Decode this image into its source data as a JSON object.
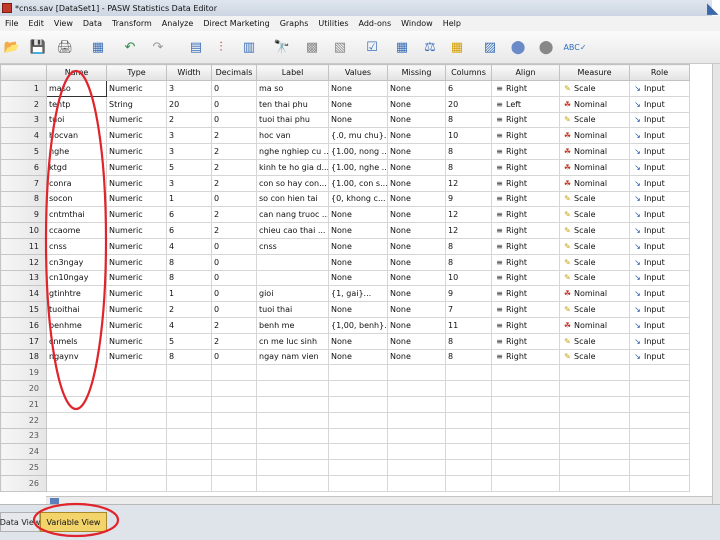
{
  "window": {
    "title": "*cnss.sav [DataSet1] - PASW Statistics Data Editor",
    "logo_glyph": "◣"
  },
  "menu": [
    "File",
    "Edit",
    "View",
    "Data",
    "Transform",
    "Analyze",
    "Direct Marketing",
    "Graphs",
    "Utilities",
    "Add-ons",
    "Window",
    "Help"
  ],
  "toolbar": {
    "icons": [
      {
        "name": "open-folder-icon",
        "glyph": "📂",
        "color": "#e0a000"
      },
      {
        "name": "save-icon",
        "glyph": "💾",
        "color": "#2e5fa8"
      },
      {
        "name": "print-icon",
        "glyph": "🖨",
        "color": "#555555"
      },
      {
        "name": "dialog-recall-icon",
        "glyph": "▦",
        "color": "#3b6fb8"
      },
      {
        "name": "undo-icon",
        "glyph": "↶",
        "color": "#2d8a4e"
      },
      {
        "name": "redo-icon",
        "glyph": "↷",
        "color": "#9a9a9a"
      },
      {
        "name": "goto-case-icon",
        "glyph": "▤",
        "color": "#3b6fb8"
      },
      {
        "name": "goto-variable-icon",
        "glyph": "⫶",
        "color": "#b03030"
      },
      {
        "name": "variables-icon",
        "glyph": "▥",
        "color": "#3b6fb8"
      },
      {
        "name": "find-icon",
        "glyph": "🔭",
        "color": "#222222"
      },
      {
        "name": "insert-cases-icon",
        "glyph": "▩",
        "color": "#888888"
      },
      {
        "name": "insert-variable-icon",
        "glyph": "▧",
        "color": "#888888"
      },
      {
        "name": "split-file-icon",
        "glyph": "☑",
        "color": "#3b6fb8"
      },
      {
        "name": "select-cases-icon",
        "glyph": "▦",
        "color": "#3b6fb8"
      },
      {
        "name": "weight-cases-icon",
        "glyph": "⚖",
        "color": "#3b6fb8"
      },
      {
        "name": "value-labels-icon",
        "glyph": "▦",
        "color": "#d4a000"
      },
      {
        "name": "use-variable-sets-icon",
        "glyph": "▨",
        "color": "#3b6fb8"
      },
      {
        "name": "show-all-variables-icon",
        "glyph": "⬤",
        "color": "#6b8ac8"
      },
      {
        "name": "circle-icon",
        "glyph": "⬤",
        "color": "#888888"
      },
      {
        "name": "spell-check-icon",
        "glyph": "ABC✓",
        "color": "#2d6fbf"
      }
    ]
  },
  "grid": {
    "columns": [
      "",
      "Name",
      "Type",
      "Width",
      "Decimals",
      "Label",
      "Values",
      "Missing",
      "Columns",
      "Align",
      "Measure",
      "Role"
    ],
    "rows": [
      {
        "num": "1",
        "name": "maso",
        "type": "Numeric",
        "width": "3",
        "decimals": "0",
        "label": "ma so",
        "values": "None",
        "missing": "None",
        "columns": "6",
        "align": "Right",
        "measure": "Scale",
        "role": "Input"
      },
      {
        "num": "2",
        "name": "tentp",
        "type": "String",
        "width": "20",
        "decimals": "0",
        "label": "ten thai phu",
        "values": "None",
        "missing": "None",
        "columns": "20",
        "align": "Left",
        "measure": "Nominal",
        "role": "Input"
      },
      {
        "num": "3",
        "name": "tuoi",
        "type": "Numeric",
        "width": "2",
        "decimals": "0",
        "label": "tuoi thai phu",
        "values": "None",
        "missing": "None",
        "columns": "8",
        "align": "Right",
        "measure": "Scale",
        "role": "Input"
      },
      {
        "num": "4",
        "name": "hocvan",
        "type": "Numeric",
        "width": "3",
        "decimals": "2",
        "label": "hoc van",
        "values": "{.0, mu chu}...",
        "missing": "None",
        "columns": "10",
        "align": "Right",
        "measure": "Nominal",
        "role": "Input"
      },
      {
        "num": "5",
        "name": "nghe",
        "type": "Numeric",
        "width": "3",
        "decimals": "2",
        "label": "nghe nghiep cu ...",
        "values": "{1.00, nong ...",
        "missing": "None",
        "columns": "8",
        "align": "Right",
        "measure": "Nominal",
        "role": "Input"
      },
      {
        "num": "6",
        "name": "ktgd",
        "type": "Numeric",
        "width": "5",
        "decimals": "2",
        "label": "kinh te ho gia d...",
        "values": "{1.00, nghe ...",
        "missing": "None",
        "columns": "8",
        "align": "Right",
        "measure": "Nominal",
        "role": "Input"
      },
      {
        "num": "7",
        "name": "conra",
        "type": "Numeric",
        "width": "3",
        "decimals": "2",
        "label": "con so hay con...",
        "values": "{1.00, con s...",
        "missing": "None",
        "columns": "12",
        "align": "Right",
        "measure": "Nominal",
        "role": "Input"
      },
      {
        "num": "8",
        "name": "socon",
        "type": "Numeric",
        "width": "1",
        "decimals": "0",
        "label": "so con hien tai",
        "values": "{0, khong c...",
        "missing": "None",
        "columns": "9",
        "align": "Right",
        "measure": "Scale",
        "role": "Input"
      },
      {
        "num": "9",
        "name": "cntmthai",
        "type": "Numeric",
        "width": "6",
        "decimals": "2",
        "label": "can nang truoc ...",
        "values": "None",
        "missing": "None",
        "columns": "12",
        "align": "Right",
        "measure": "Scale",
        "role": "Input"
      },
      {
        "num": "10",
        "name": "ccaome",
        "type": "Numeric",
        "width": "6",
        "decimals": "2",
        "label": "chieu cao thai ...",
        "values": "None",
        "missing": "None",
        "columns": "12",
        "align": "Right",
        "measure": "Scale",
        "role": "Input"
      },
      {
        "num": "11",
        "name": "cnss",
        "type": "Numeric",
        "width": "4",
        "decimals": "0",
        "label": "cnss",
        "values": "None",
        "missing": "None",
        "columns": "8",
        "align": "Right",
        "measure": "Scale",
        "role": "Input"
      },
      {
        "num": "12",
        "name": "cn3ngay",
        "type": "Numeric",
        "width": "8",
        "decimals": "0",
        "label": "",
        "values": "None",
        "missing": "None",
        "columns": "8",
        "align": "Right",
        "measure": "Scale",
        "role": "Input"
      },
      {
        "num": "13",
        "name": "cn10ngay",
        "type": "Numeric",
        "width": "8",
        "decimals": "0",
        "label": "",
        "values": "None",
        "missing": "None",
        "columns": "10",
        "align": "Right",
        "measure": "Scale",
        "role": "Input"
      },
      {
        "num": "14",
        "name": "gtinhtre",
        "type": "Numeric",
        "width": "1",
        "decimals": "0",
        "label": "gioi",
        "values": "{1, gai}...",
        "missing": "None",
        "columns": "9",
        "align": "Right",
        "measure": "Nominal",
        "role": "Input"
      },
      {
        "num": "15",
        "name": "tuoithai",
        "type": "Numeric",
        "width": "2",
        "decimals": "0",
        "label": "tuoi thai",
        "values": "None",
        "missing": "None",
        "columns": "7",
        "align": "Right",
        "measure": "Scale",
        "role": "Input"
      },
      {
        "num": "16",
        "name": "benhme",
        "type": "Numeric",
        "width": "4",
        "decimals": "2",
        "label": "benh me",
        "values": "{1,00, benh}...",
        "missing": "None",
        "columns": "11",
        "align": "Right",
        "measure": "Nominal",
        "role": "Input"
      },
      {
        "num": "17",
        "name": "cnmels",
        "type": "Numeric",
        "width": "5",
        "decimals": "2",
        "label": "cn me luc sinh",
        "values": "None",
        "missing": "None",
        "columns": "8",
        "align": "Right",
        "measure": "Scale",
        "role": "Input"
      },
      {
        "num": "18",
        "name": "ngaynv",
        "type": "Numeric",
        "width": "8",
        "decimals": "0",
        "label": "ngay nam vien",
        "values": "None",
        "missing": "None",
        "columns": "8",
        "align": "Right",
        "measure": "Scale",
        "role": "Input"
      }
    ],
    "empty_rows": [
      "19",
      "20",
      "21",
      "22",
      "23",
      "24",
      "25",
      "26"
    ],
    "icon_glyphs": {
      "align_left": "≡",
      "align_right": "≡",
      "scale": "✎",
      "nominal": "☘",
      "input": "↘"
    }
  },
  "tabs": {
    "data_view": "Data View",
    "variable_view": "Variable View"
  },
  "colors": {
    "annotation": "#e0242b",
    "active_tab": "#f3d46a",
    "scale_icon": "#c8a000",
    "nominal_icon": "#c0392b",
    "role_icon": "#1f5aa8"
  }
}
